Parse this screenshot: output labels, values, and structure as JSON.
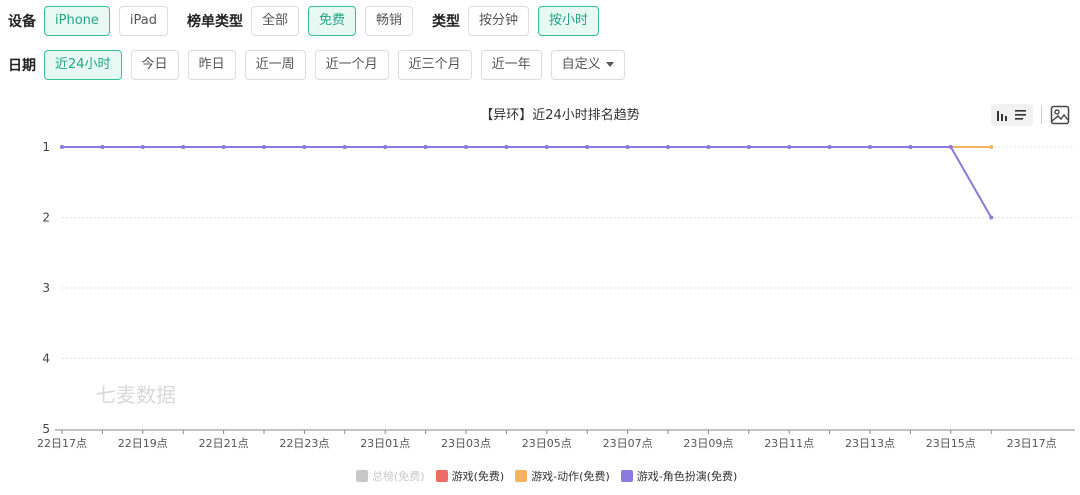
{
  "filters": {
    "device": {
      "label": "设备",
      "options": [
        "iPhone",
        "iPad"
      ],
      "active": "iPhone"
    },
    "chart_type": {
      "label": "榜单类型",
      "options": [
        "全部",
        "免费",
        "畅销"
      ],
      "active": "免费"
    },
    "type": {
      "label": "类型",
      "options": [
        "按分钟",
        "按小时"
      ],
      "active": "按小时"
    },
    "date": {
      "label": "日期",
      "options": [
        "近24小时",
        "今日",
        "昨日",
        "近一周",
        "近一个月",
        "近三个月",
        "近一年"
      ],
      "active": "近24小时",
      "custom_label": "自定义"
    }
  },
  "toolbar": {
    "bar_icon": "bar-chart-icon",
    "list_icon": "list-icon",
    "save_icon": "image-icon"
  },
  "chart_data": {
    "type": "line",
    "title": "【异环】近24小时排名趋势",
    "watermark": "七麦数据",
    "ylim": [
      5,
      1
    ],
    "y_ticks": [
      1,
      2,
      3,
      4,
      5
    ],
    "y_reversed": true,
    "x": [
      "22日17点",
      "22日18点",
      "22日19点",
      "22日20点",
      "22日21点",
      "22日22点",
      "22日23点",
      "23日00点",
      "23日01点",
      "23日02点",
      "23日03点",
      "23日04点",
      "23日05点",
      "23日06点",
      "23日07点",
      "23日08点",
      "23日09点",
      "23日10点",
      "23日11点",
      "23日12点",
      "23日13点",
      "23日14点",
      "23日15点",
      "23日16点"
    ],
    "x_tick_labels": [
      "22日17点",
      "22日19点",
      "22日21点",
      "22日23点",
      "23日01点",
      "23日03点",
      "23日05点",
      "23日07点",
      "23日09点",
      "23日11点",
      "23日13点",
      "23日15点",
      "23日17点"
    ],
    "series": [
      {
        "name": "总榜(免费)",
        "color": "#c8c8c8",
        "disabled": true,
        "values": []
      },
      {
        "name": "游戏(免费)",
        "color": "#ef6b63",
        "disabled": false,
        "values": []
      },
      {
        "name": "游戏-动作(免费)",
        "color": "#f5b35f",
        "disabled": false,
        "values": [
          1,
          1,
          1,
          1,
          1,
          1,
          1,
          1,
          1,
          1,
          1,
          1,
          1,
          1,
          1,
          1,
          1,
          1,
          1,
          1,
          1,
          1,
          1,
          1
        ]
      },
      {
        "name": "游戏-角色扮演(免费)",
        "color": "#8a7ae0",
        "disabled": false,
        "values": [
          1,
          1,
          1,
          1,
          1,
          1,
          1,
          1,
          1,
          1,
          1,
          1,
          1,
          1,
          1,
          1,
          1,
          1,
          1,
          1,
          1,
          1,
          1,
          2
        ]
      }
    ],
    "grid": true,
    "legend_position": "bottom-center"
  }
}
